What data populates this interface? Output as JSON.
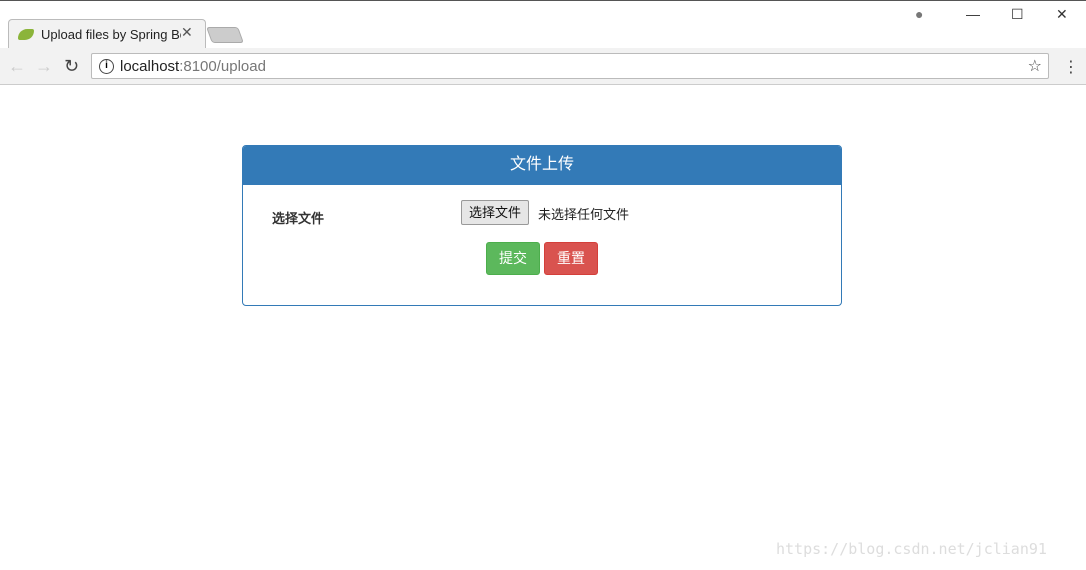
{
  "browser": {
    "tab_title": "Upload files by Spring Boot",
    "url_host": "localhost",
    "url_path": ":8100/upload"
  },
  "panel": {
    "title": "文件上传",
    "label": "选择文件",
    "file_button": "选择文件",
    "file_status": "未选择任何文件",
    "submit": "提交",
    "reset": "重置"
  },
  "colors": {
    "primary": "#337ab7",
    "success": "#5cb85c",
    "danger": "#d9534f"
  },
  "watermark": "https://blog.csdn.net/jclian91"
}
